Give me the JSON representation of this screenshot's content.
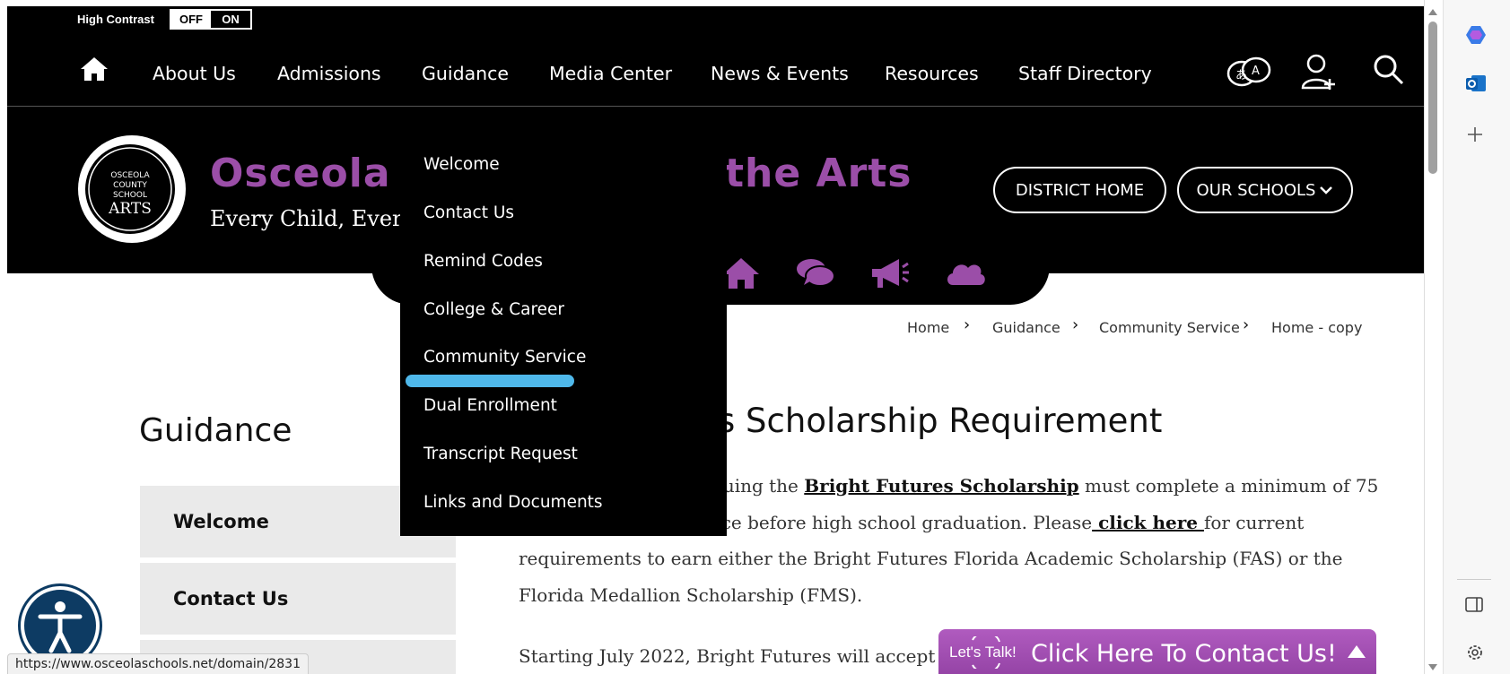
{
  "accessibility": {
    "high_contrast_label": "High Contrast",
    "off_label": "OFF",
    "on_label": "ON"
  },
  "nav": {
    "items": [
      "About Us",
      "Admissions",
      "Guidance",
      "Media Center",
      "News & Events",
      "Resources",
      "Staff Directory"
    ]
  },
  "header": {
    "school_name_left": "Osceola C",
    "school_name_right": "the Arts",
    "tagline": "Every Child, Every (",
    "district_home": "DISTRICT HOME",
    "our_schools": "OUR SCHOOLS",
    "logo_text": "OSCEOLA COUNTY SCHOOL for the ARTS"
  },
  "breadcrumb": [
    "Home",
    "Guidance",
    "Community Service",
    "Home - copy"
  ],
  "dropdown": {
    "items": [
      "Welcome",
      "Contact Us",
      "Remind Codes",
      "College & Career",
      "Community Service",
      "Dual Enrollment",
      "Transcript Request",
      "Links and Documents"
    ]
  },
  "sidebar": {
    "title": "Guidance",
    "items": [
      "Welcome",
      "Contact Us"
    ]
  },
  "article": {
    "title": "s Scholarship Requirement",
    "line1_pre": "rsuing the ",
    "line1_link": "Bright Futures Scholarship",
    "line1_post": " must complete a minimum of 75",
    "line2_pre": "vice before high school graduation. Please",
    "line2_link": " click here ",
    "line2_post": " for current",
    "line3": "requirements to earn either the Bright Futures Florida Academic Scholarship (FAS) or the",
    "line4": "Florida Medallion Scholarship (FMS).",
    "line5": "Starting July 2022, Bright Futures will accept pai"
  },
  "status": {
    "url": "https://www.osceolaschools.net/domain/2831"
  },
  "contact": {
    "badge": "Let's Talk!",
    "text": "Click Here To Contact Us!"
  },
  "icons": {
    "home": "home-icon",
    "translate": "translate-icon",
    "user": "user-add-icon",
    "search": "search-icon",
    "quick": [
      "home-icon",
      "chat-icon",
      "megaphone-icon",
      "cloud-icon"
    ],
    "accessibility": "accessibility-icon",
    "sidebar": [
      "copilot-icon",
      "outlook-icon",
      "plus-icon",
      "panel-icon",
      "settings-icon"
    ]
  },
  "colors": {
    "brand_purple": "#9b4ea8",
    "highlight": "#4fb8ea",
    "access_blue": "#0d3b63"
  }
}
